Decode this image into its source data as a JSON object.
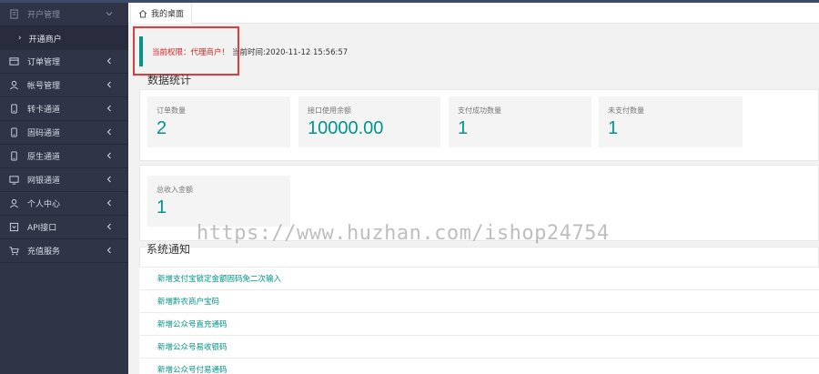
{
  "sidebar": {
    "header": {
      "label": "开户管理",
      "icon": "document-icon"
    },
    "sub_item": {
      "label": "开通商户"
    },
    "items": [
      {
        "label": "订单管理",
        "icon": "wallet-icon"
      },
      {
        "label": "帐号管理",
        "icon": "user-icon"
      },
      {
        "label": "转卡通道",
        "icon": "phone-icon"
      },
      {
        "label": "固码通道",
        "icon": "phone-icon"
      },
      {
        "label": "原生通道",
        "icon": "phone-icon"
      },
      {
        "label": "网银通道",
        "icon": "monitor-icon"
      },
      {
        "label": "个人中心",
        "icon": "user-icon"
      },
      {
        "label": "API接口",
        "icon": "api-icon"
      },
      {
        "label": "充值服务",
        "icon": "cart-icon"
      }
    ]
  },
  "tabs": [
    {
      "label": "我的桌面",
      "icon": "home-icon"
    }
  ],
  "notice": {
    "permission": "当前权限：代理商户！",
    "time": "当前时间:2020-11-12 15:56:57"
  },
  "stats_section": {
    "title": "数据统计",
    "row1": [
      {
        "label": "订单数量",
        "value": "2"
      },
      {
        "label": "接口使用余额",
        "value": "10000.00"
      },
      {
        "label": "支付成功数量",
        "value": "1"
      },
      {
        "label": "未支付数量",
        "value": "1"
      }
    ],
    "row2": [
      {
        "label": "总收入金额",
        "value": "1"
      }
    ]
  },
  "system_notice": {
    "title": "系统通知",
    "items": [
      "新增支付宝锁定金额固码免二次输入",
      "新增黔农商户宝码",
      "新增公众号直充通码",
      "新增公众号易收银码",
      "新增公众号付易通码"
    ]
  },
  "watermark": "https://www.huzhan.com/ishop24754",
  "colors": {
    "accent": "#009688",
    "sidebar_bg": "#2f3447",
    "alert_red": "#e02020"
  }
}
